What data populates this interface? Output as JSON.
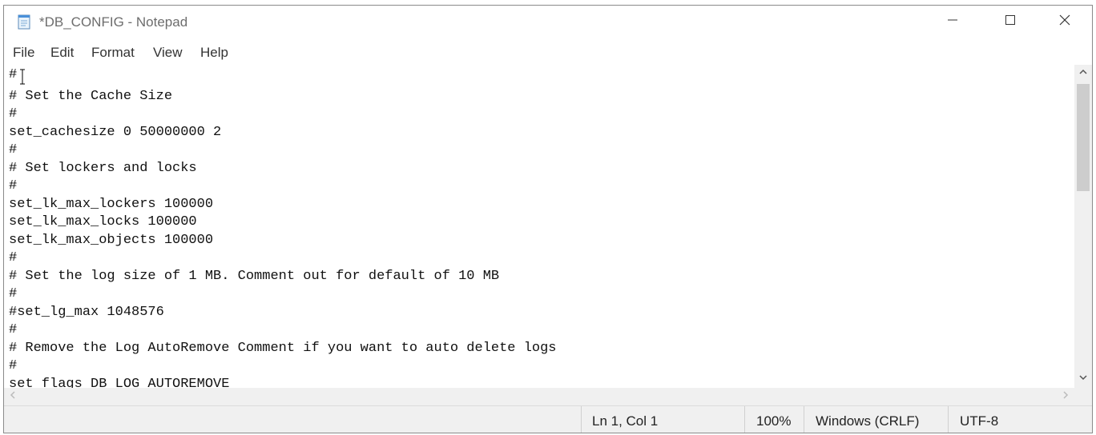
{
  "window": {
    "title": "*DB_CONFIG - Notepad"
  },
  "menu": [
    "File",
    "Edit",
    "Format",
    "View",
    "Help"
  ],
  "editor_lines": [
    "#",
    "# Set the Cache Size",
    "#",
    "set_cachesize 0 50000000 2",
    "#",
    "# Set lockers and locks",
    "#",
    "set_lk_max_lockers 100000",
    "set_lk_max_locks 100000",
    "set_lk_max_objects 100000",
    "#",
    "# Set the log size of 1 MB. Comment out for default of 10 MB",
    "#",
    "#set_lg_max 1048576",
    "#",
    "# Remove the Log AutoRemove Comment if you want to auto delete logs",
    "#",
    "set flags DB LOG AUTOREMOVE"
  ],
  "status": {
    "position": "Ln 1, Col 1",
    "zoom": "100%",
    "line_ending": "Windows (CRLF)",
    "encoding": "UTF-8"
  },
  "icons": {
    "app": "notepad-icon",
    "minimize": "minimize-icon",
    "maximize": "maximize-icon",
    "close": "close-icon"
  }
}
